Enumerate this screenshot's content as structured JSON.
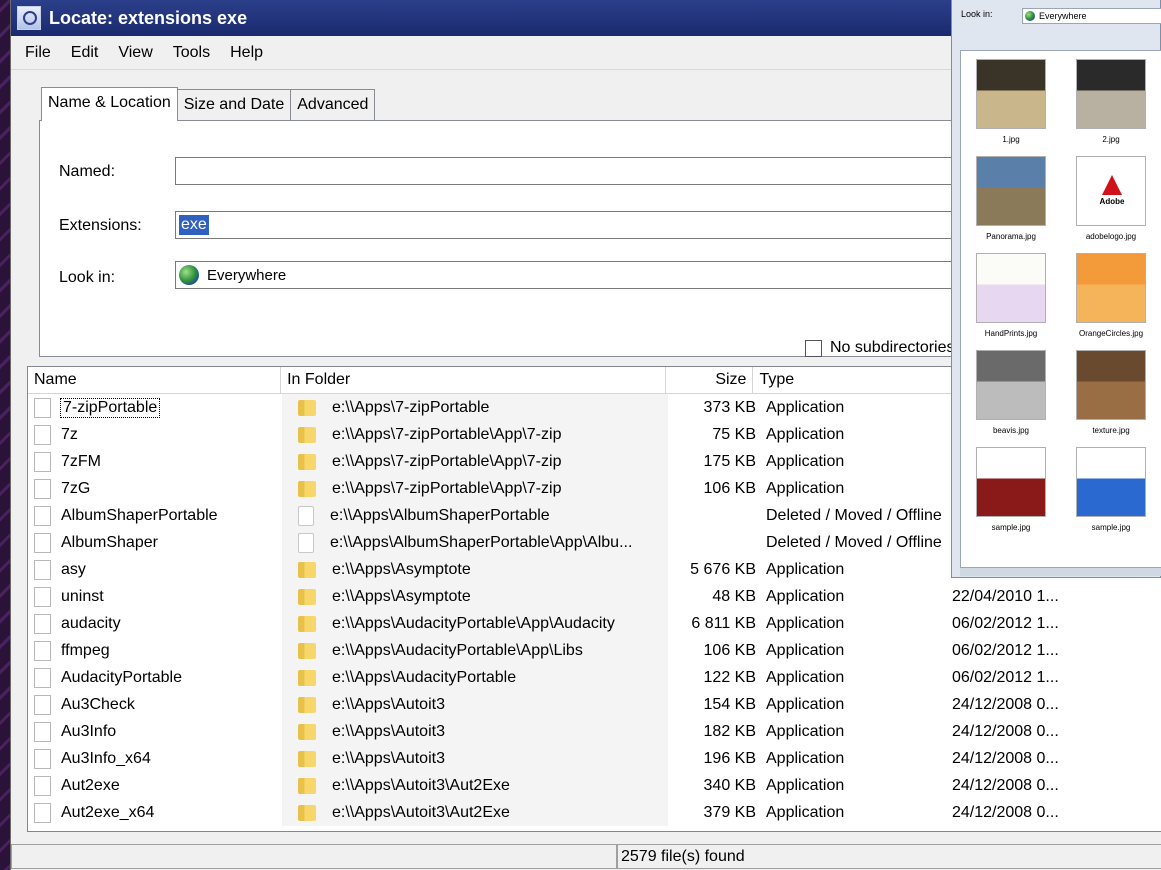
{
  "window": {
    "title": "Locate: extensions exe"
  },
  "menu": [
    "File",
    "Edit",
    "View",
    "Tools",
    "Help"
  ],
  "tabs": [
    "Name & Location",
    "Size and Date",
    "Advanced"
  ],
  "form": {
    "named_label": "Named:",
    "named_value": "",
    "extensions_label": "Extensions:",
    "extensions_value": "exe",
    "lookin_label": "Look in:",
    "lookin_value": "Everywhere",
    "no_subdirs_label": "No subdirectories"
  },
  "columns": [
    "Name",
    "In Folder",
    "Size",
    "Type"
  ],
  "rows": [
    {
      "name": "7-zipPortable",
      "folder": "e:\\\\Apps\\7-zipPortable",
      "size": "373 KB",
      "type": "Application",
      "date": "",
      "folder_icon": "folder"
    },
    {
      "name": "7z",
      "folder": "e:\\\\Apps\\7-zipPortable\\App\\7-zip",
      "size": "75 KB",
      "type": "Application",
      "date": "",
      "folder_icon": "folder"
    },
    {
      "name": "7zFM",
      "folder": "e:\\\\Apps\\7-zipPortable\\App\\7-zip",
      "size": "175 KB",
      "type": "Application",
      "date": "",
      "folder_icon": "folder"
    },
    {
      "name": "7zG",
      "folder": "e:\\\\Apps\\7-zipPortable\\App\\7-zip",
      "size": "106 KB",
      "type": "Application",
      "date": "",
      "folder_icon": "folder"
    },
    {
      "name": "AlbumShaperPortable",
      "folder": "e:\\\\Apps\\AlbumShaperPortable",
      "size": "",
      "type": "Deleted / Moved / Offline",
      "date": "",
      "folder_icon": "blank"
    },
    {
      "name": "AlbumShaper",
      "folder": "e:\\\\Apps\\AlbumShaperPortable\\App\\Albu...",
      "size": "",
      "type": "Deleted / Moved / Offline",
      "date": "",
      "folder_icon": "blank"
    },
    {
      "name": "asy",
      "folder": "e:\\\\Apps\\Asymptote",
      "size": "5 676 KB",
      "type": "Application",
      "date": "",
      "folder_icon": "folder"
    },
    {
      "name": "uninst",
      "folder": "e:\\\\Apps\\Asymptote",
      "size": "48 KB",
      "type": "Application",
      "date": "22/04/2010 1...",
      "folder_icon": "folder"
    },
    {
      "name": "audacity",
      "folder": "e:\\\\Apps\\AudacityPortable\\App\\Audacity",
      "size": "6 811 KB",
      "type": "Application",
      "date": "06/02/2012 1...",
      "folder_icon": "folder"
    },
    {
      "name": "ffmpeg",
      "folder": "e:\\\\Apps\\AudacityPortable\\App\\Libs",
      "size": "106 KB",
      "type": "Application",
      "date": "06/02/2012 1...",
      "folder_icon": "folder"
    },
    {
      "name": "AudacityPortable",
      "folder": "e:\\\\Apps\\AudacityPortable",
      "size": "122 KB",
      "type": "Application",
      "date": "06/02/2012 1...",
      "folder_icon": "folder"
    },
    {
      "name": "Au3Check",
      "folder": "e:\\\\Apps\\Autoit3",
      "size": "154 KB",
      "type": "Application",
      "date": "24/12/2008 0...",
      "folder_icon": "folder"
    },
    {
      "name": "Au3Info",
      "folder": "e:\\\\Apps\\Autoit3",
      "size": "182 KB",
      "type": "Application",
      "date": "24/12/2008 0...",
      "folder_icon": "folder"
    },
    {
      "name": "Au3Info_x64",
      "folder": "e:\\\\Apps\\Autoit3",
      "size": "196 KB",
      "type": "Application",
      "date": "24/12/2008 0...",
      "folder_icon": "folder"
    },
    {
      "name": "Aut2exe",
      "folder": "e:\\\\Apps\\Autoit3\\Aut2Exe",
      "size": "340 KB",
      "type": "Application",
      "date": "24/12/2008 0...",
      "folder_icon": "folder"
    },
    {
      "name": "Aut2exe_x64",
      "folder": "e:\\\\Apps\\Autoit3\\Aut2Exe",
      "size": "379 KB",
      "type": "Application",
      "date": "24/12/2008 0...",
      "folder_icon": "folder"
    }
  ],
  "status": {
    "found": "2579 file(s) found"
  },
  "overlay": {
    "lookin_label": "Look in:",
    "lookin_value": "Everywhere",
    "thumbs": [
      {
        "caption": "1.jpg",
        "colors": [
          "#3a3428",
          "#c9b68a"
        ]
      },
      {
        "caption": "2.jpg",
        "colors": [
          "#2a2a2a",
          "#b8b0a0"
        ]
      },
      {
        "caption": "Panorama.jpg",
        "colors": [
          "#5a7fa8",
          "#8a7a5a"
        ]
      },
      {
        "caption": "adobelogo.jpg",
        "colors": [
          "#ffffff",
          "#d0101a"
        ],
        "logo": "Adobe"
      },
      {
        "caption": "HandPrints.jpg",
        "colors": [
          "#fbfbf8",
          "#e7d7f0"
        ]
      },
      {
        "caption": "OrangeCircles.jpg",
        "colors": [
          "#f39a3a",
          "#f5b45a"
        ]
      },
      {
        "caption": "beavis.jpg",
        "colors": [
          "#6a6a6a",
          "#bcbcbc"
        ]
      },
      {
        "caption": "texture.jpg",
        "colors": [
          "#6a4a2e",
          "#9a6e44"
        ]
      },
      {
        "caption": "sample.jpg",
        "colors": [
          "#ffffff",
          "#8a1a1a"
        ]
      },
      {
        "caption": "sample.jpg",
        "colors": [
          "#ffffff",
          "#2a6ad0"
        ]
      }
    ]
  }
}
